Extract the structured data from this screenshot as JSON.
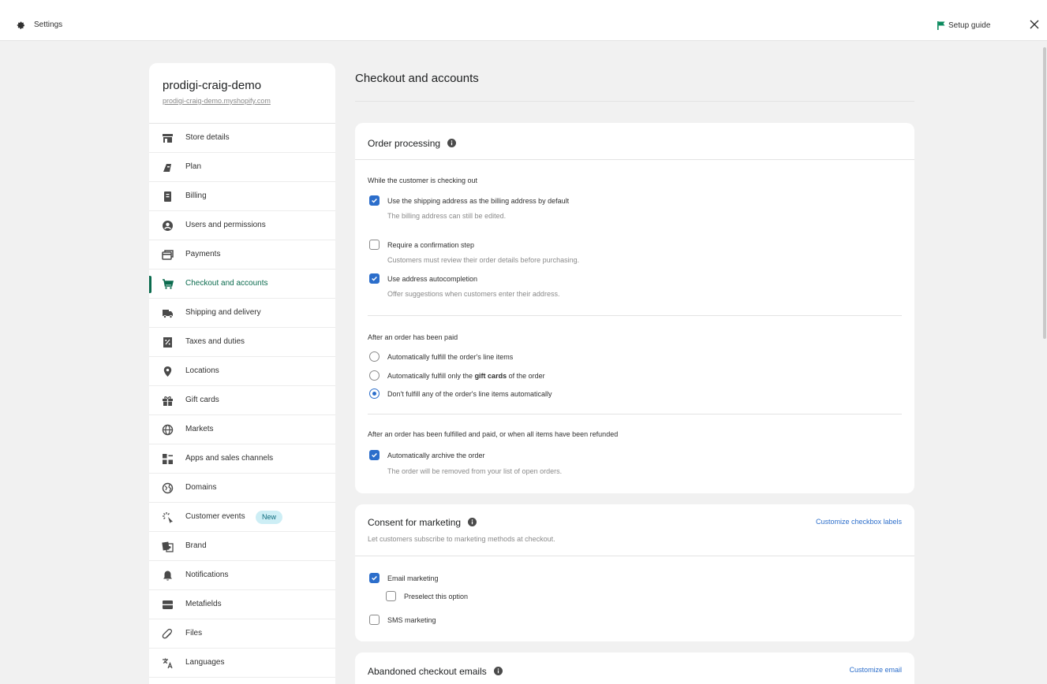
{
  "topbar": {
    "title": "Settings",
    "setup_guide": "Setup guide"
  },
  "colors": {
    "accent": "#2c6ecb",
    "active_nav": "#0b6b4e",
    "badge_bg": "#cdeef5"
  },
  "store": {
    "name": "prodigi-craig-demo",
    "url": "prodigi-craig-demo.myshopify.com"
  },
  "sidebar": {
    "items": [
      {
        "label": "Store details",
        "icon": "store-icon"
      },
      {
        "label": "Plan",
        "icon": "plan-icon"
      },
      {
        "label": "Billing",
        "icon": "billing-icon"
      },
      {
        "label": "Users and permissions",
        "icon": "user-icon"
      },
      {
        "label": "Payments",
        "icon": "payments-icon"
      },
      {
        "label": "Checkout and accounts",
        "icon": "cart-icon",
        "active": true
      },
      {
        "label": "Shipping and delivery",
        "icon": "truck-icon"
      },
      {
        "label": "Taxes and duties",
        "icon": "tax-icon"
      },
      {
        "label": "Locations",
        "icon": "location-icon"
      },
      {
        "label": "Gift cards",
        "icon": "gift-icon"
      },
      {
        "label": "Markets",
        "icon": "globe-icon"
      },
      {
        "label": "Apps and sales channels",
        "icon": "apps-icon"
      },
      {
        "label": "Domains",
        "icon": "domains-icon"
      },
      {
        "label": "Customer events",
        "icon": "events-icon",
        "badge": "New"
      },
      {
        "label": "Brand",
        "icon": "brand-icon"
      },
      {
        "label": "Notifications",
        "icon": "bell-icon"
      },
      {
        "label": "Metafields",
        "icon": "metafields-icon"
      },
      {
        "label": "Files",
        "icon": "paperclip-icon"
      },
      {
        "label": "Languages",
        "icon": "language-icon"
      }
    ]
  },
  "main": {
    "title": "Checkout and accounts",
    "order_processing": {
      "title": "Order processing",
      "while_checking_out": "While the customer is checking out",
      "shipping_as_billing": {
        "label": "Use the shipping address as the billing address by default",
        "help": "The billing address can still be edited.",
        "checked": true
      },
      "confirmation_step": {
        "label": "Require a confirmation step",
        "help": "Customers must review their order details before purchasing.",
        "checked": false
      },
      "autocompletion": {
        "label": "Use address autocompletion",
        "help": "Offer suggestions when customers enter their address.",
        "checked": true
      },
      "after_paid": "After an order has been paid",
      "fulfill_all": "Automatically fulfill the order's line items",
      "fulfill_gift_pre": "Automatically fulfill only the ",
      "fulfill_gift_bold": "gift cards",
      "fulfill_gift_post": " of the order",
      "fulfill_none": "Don't fulfill any of the order's line items automatically",
      "selected_option": "fulfill_none",
      "after_fulfilled": "After an order has been fulfilled and paid, or when all items have been refunded",
      "archive": {
        "label": "Automatically archive the order",
        "help": "The order will be removed from your list of open orders.",
        "checked": true
      }
    },
    "consent": {
      "title": "Consent for marketing",
      "subtitle": "Let customers subscribe to marketing methods at checkout.",
      "customize_link": "Customize checkbox labels",
      "email_marketing": {
        "label": "Email marketing",
        "checked": true
      },
      "preselect": {
        "label": "Preselect this option",
        "checked": false
      },
      "sms_marketing": {
        "label": "SMS marketing",
        "checked": false
      }
    },
    "abandoned": {
      "title": "Abandoned checkout emails",
      "customize_link": "Customize email"
    }
  }
}
